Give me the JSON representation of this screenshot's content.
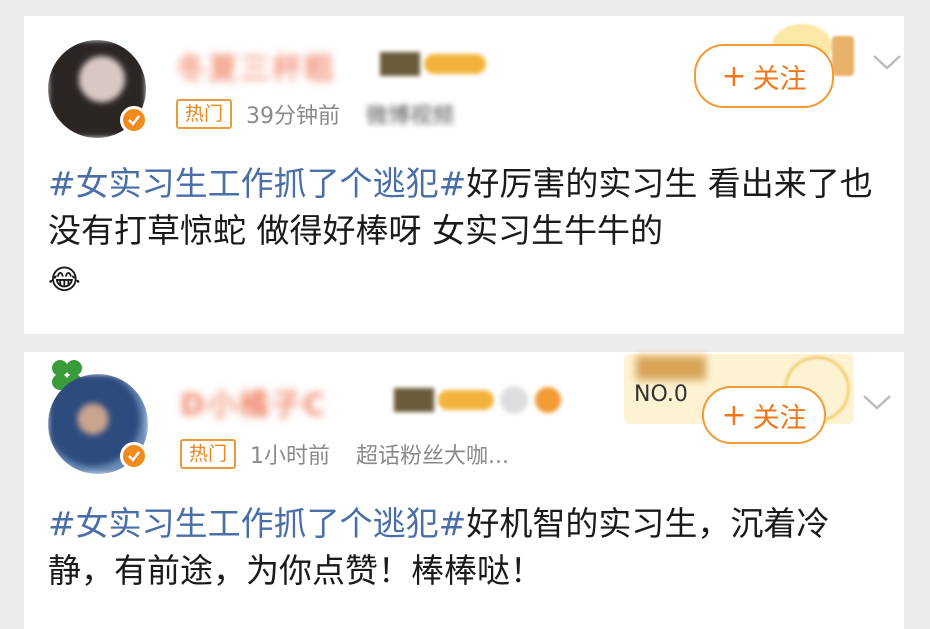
{
  "posts": [
    {
      "username": "冬夏三杯粗",
      "badge": "热门",
      "time": "39分钟前",
      "source": "微博视频",
      "follow_label": "关注",
      "topic": "#女实习生工作抓了个逃犯#",
      "text": "好厉害的实习生 看出来了也没有打草惊蛇 做得好棒呀 女实习生牛牛的",
      "emoji": "😂"
    },
    {
      "username": "D小橘子C",
      "badge": "热门",
      "time": "1小时前",
      "source": "超话粉丝大咖...",
      "rank_label": "NO.0",
      "follow_label": "关注",
      "topic": "#女实习生工作抓了个逃犯#",
      "text": "好机智的实习生，沉着冷静，有前途，为你点赞！棒棒哒！"
    }
  ],
  "colors": {
    "accent": "#f2761a",
    "topic": "#4a6ea8",
    "verified": "#f28b1d"
  }
}
